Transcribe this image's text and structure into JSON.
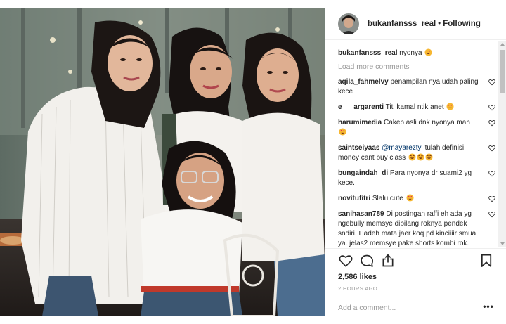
{
  "post": {
    "author": "bukanfansss_real",
    "separator": "•",
    "follow_status": "Following"
  },
  "caption": {
    "user": "bukanfansss_real",
    "text": "nyonya"
  },
  "load_more": "Load more comments",
  "comments": [
    {
      "user": "aqila_fahmelvy",
      "text": "penampilan nya udah paling kece"
    },
    {
      "user": "e___argarenti",
      "text": "Titi kamal ntik anet"
    },
    {
      "user": "harumimedia",
      "text": "Cakep asli dnk nyonya mah"
    },
    {
      "user": "saintseiyaas",
      "mention": "@mayarezty",
      "text": "itulah definisi money cant buy class"
    },
    {
      "user": "bungaindah_di",
      "text": "Para nyonya dr suami2 yg kece."
    },
    {
      "user": "novitufitri",
      "text": "Slalu cute"
    },
    {
      "user": "sanihasan789",
      "text": "Di postingan raffi eh ada yg ngebully memsye dibilang roknya pendek sndiri. Hadeh mata jaer koq pd kinciiiir smua ya. jelas2 memsye pake shorts kombi rok."
    }
  ],
  "likes": "2,586 likes",
  "timestamp": "2 HOURS AGO",
  "add_comment": {
    "placeholder": "Add a comment..."
  },
  "more_options": "•••",
  "icons": {
    "like": "heart-icon",
    "comment": "comment-bubble-icon",
    "share": "share-icon",
    "save": "bookmark-icon",
    "comment_like": "small-heart-icon",
    "emoji_love": "heart-eyes-emoji",
    "emoji_laugh": "laughing-emoji"
  },
  "colors": {
    "text": "#262626",
    "secondary_text": "#999999",
    "divider": "#efefef",
    "mention": "#003569",
    "emoji": "#f7b731"
  }
}
